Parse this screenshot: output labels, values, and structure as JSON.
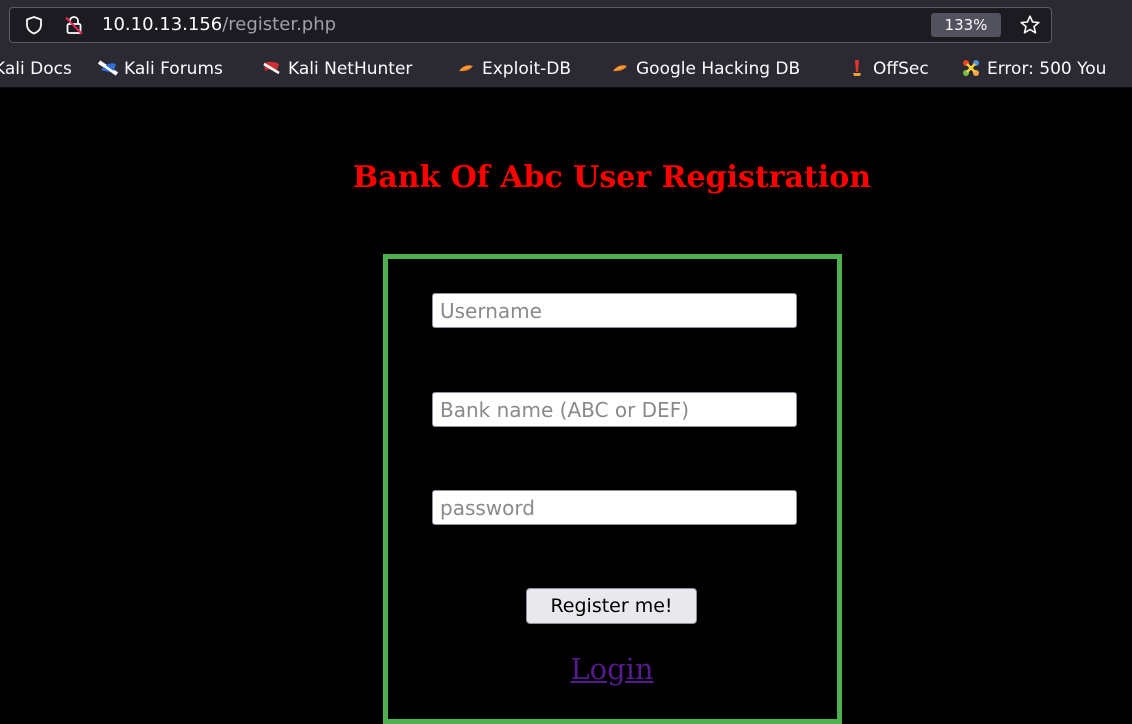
{
  "browser": {
    "url_host": "10.10.13.156",
    "url_path": "/register.php",
    "zoom": "133%",
    "icons": {
      "tracking_protection": "shield-icon",
      "security": "insecure-lock-icon",
      "bookmark": "star-icon"
    },
    "bookmarks": [
      {
        "label": "Kali Docs",
        "icon": "kali-docs-icon"
      },
      {
        "label": "Kali Forums",
        "icon": "kali-forums-icon"
      },
      {
        "label": "Kali NetHunter",
        "icon": "kali-nethunter-icon"
      },
      {
        "label": "Exploit-DB",
        "icon": "exploit-db-icon"
      },
      {
        "label": "Google Hacking DB",
        "icon": "google-hacking-db-icon"
      },
      {
        "label": "OffSec",
        "icon": "offsec-icon"
      },
      {
        "label": "Error: 500 You",
        "icon": "joomla-icon"
      }
    ]
  },
  "page": {
    "title": "Bank Of Abc User Registration",
    "form": {
      "username_placeholder": "Username",
      "bank_placeholder": "Bank name (ABC or DEF)",
      "password_placeholder": "password",
      "submit_label": "Register me!"
    },
    "login_link": "Login"
  },
  "colors": {
    "background": "#000000",
    "title": "#ff0000",
    "box_border": "#4caf50",
    "link": "#551a8b"
  }
}
